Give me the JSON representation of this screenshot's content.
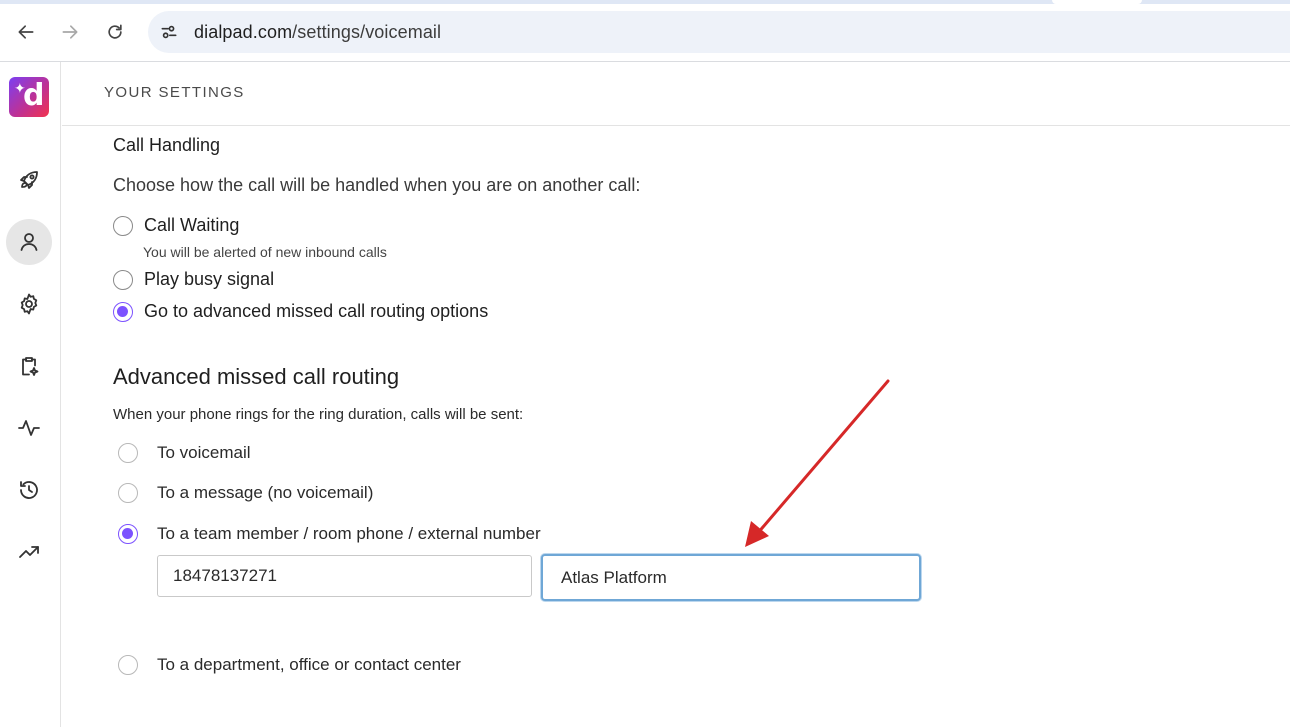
{
  "browser": {
    "url_host": "dialpad.com",
    "url_path": "/settings/voicemail"
  },
  "header": {
    "title": "YOUR SETTINGS"
  },
  "call_handling": {
    "label": "Call Handling",
    "prompt": "Choose how the call will be handled when you are on another call:",
    "options": [
      {
        "label": "Call Waiting",
        "help": "You will be alerted of new inbound calls",
        "checked": false
      },
      {
        "label": "Play busy signal",
        "checked": false
      },
      {
        "label": "Go to advanced missed call routing options",
        "checked": true
      }
    ]
  },
  "advanced_routing": {
    "title": "Advanced missed call routing",
    "description": "When your phone rings for the ring duration, calls will be sent:",
    "options": [
      {
        "label": "To voicemail",
        "checked": false
      },
      {
        "label": "To a message (no voicemail)",
        "checked": false
      },
      {
        "label": "To a team member / room phone / external number",
        "checked": true
      },
      {
        "label": "To a department, office or contact center",
        "checked": false
      }
    ],
    "number_input_value": "18478137271",
    "name_input_value": "Atlas Platform"
  },
  "colors": {
    "accent": "#7c52ff",
    "focus_border": "#6fa7d6",
    "annotation_arrow": "#d62828"
  },
  "icons": {
    "rail": [
      "rocket-icon",
      "person-icon",
      "gear-icon",
      "clipboard-sparkle-icon",
      "pulse-icon",
      "history-icon",
      "trending-up-icon"
    ]
  }
}
